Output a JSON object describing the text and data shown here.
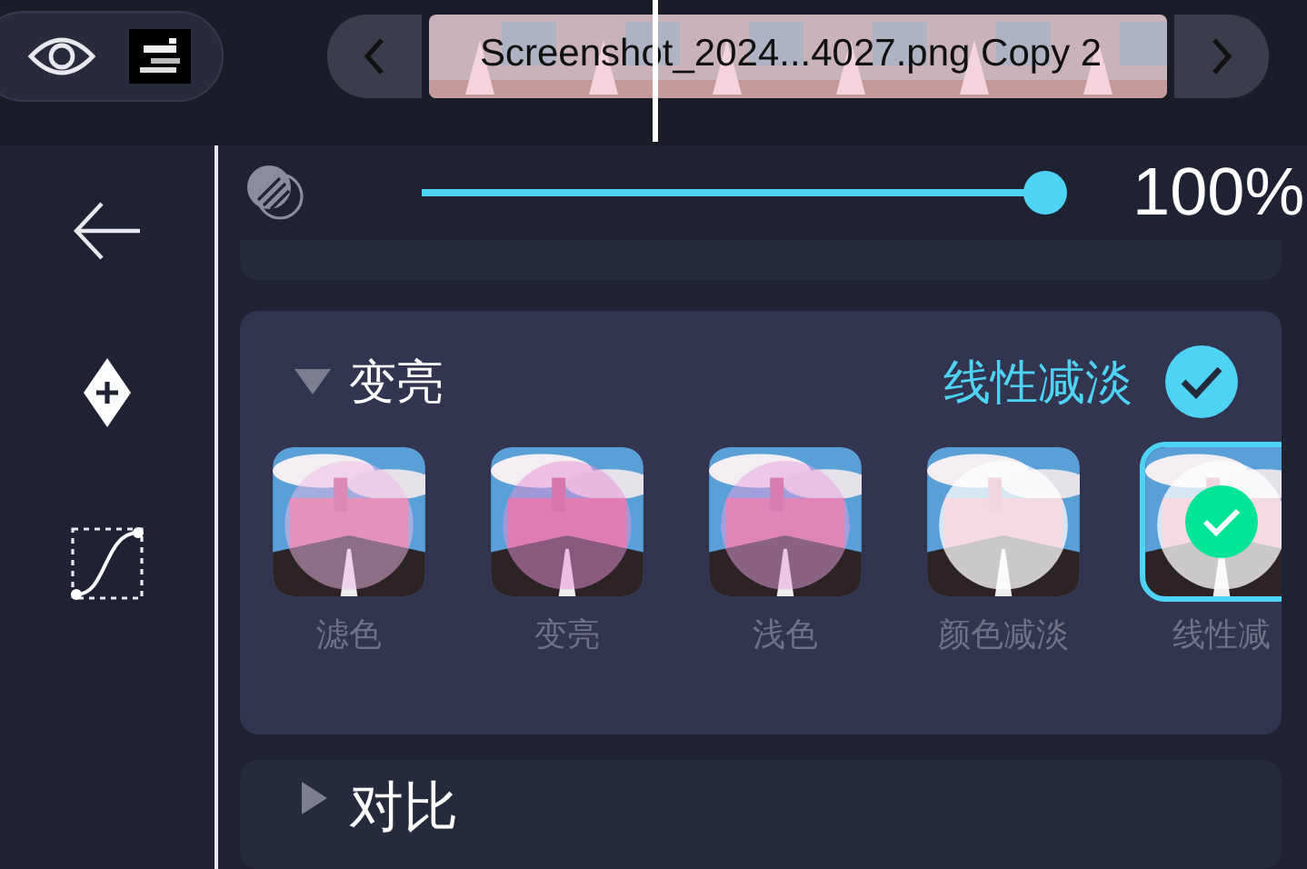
{
  "toolbar": {
    "filename": "Screenshot_2024...4027.png Copy 2"
  },
  "opacity": {
    "level": 1,
    "reading": "100%"
  },
  "group": {
    "title": "变亮",
    "expanded": true,
    "selected_mode": "线性减淡",
    "modes": [
      {
        "label": "滤色",
        "selected": false
      },
      {
        "label": "变亮",
        "selected": false
      },
      {
        "label": "浅色",
        "selected": false
      },
      {
        "label": "颜色减淡",
        "selected": false
      },
      {
        "label": "线性减",
        "selected": true
      }
    ]
  },
  "next_group": {
    "title": "对比",
    "expanded": false
  }
}
